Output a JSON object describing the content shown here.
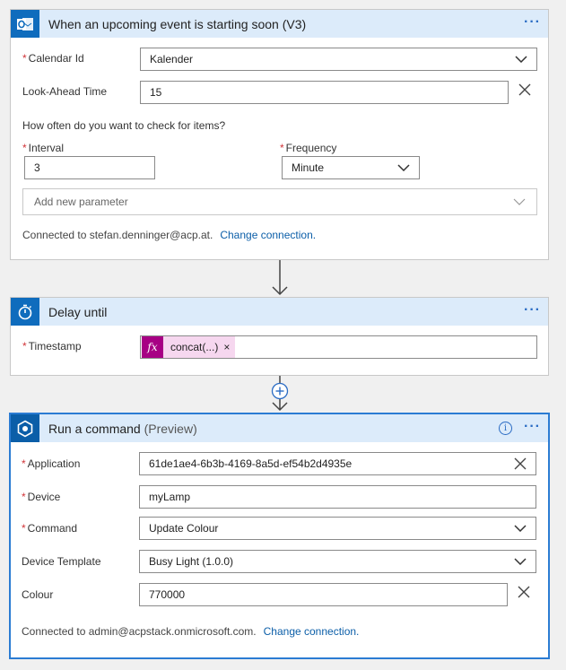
{
  "trigger": {
    "title": "When an upcoming event is starting soon (V3)",
    "calendar_id_label": "Calendar Id",
    "calendar_id_value": "Kalender",
    "lookahead_label": "Look-Ahead Time",
    "lookahead_value": "15",
    "question": "How often do you want to check for items?",
    "interval_label": "Interval",
    "interval_value": "3",
    "frequency_label": "Frequency",
    "frequency_value": "Minute",
    "add_param_placeholder": "Add new parameter",
    "connected_text": "Connected to stefan.denninger@acp.at.",
    "change_connection": "Change connection."
  },
  "delay": {
    "title": "Delay until",
    "timestamp_label": "Timestamp",
    "token_label": "concat(...)",
    "token_remove": "×",
    "fx": "fx"
  },
  "command": {
    "title": "Run a command",
    "subtitle": "(Preview)",
    "application_label": "Application",
    "application_value": "61de1ae4-6b3b-4169-8a5d-ef54b2d4935e",
    "device_label": "Device",
    "device_value": "myLamp",
    "command_label": "Command",
    "command_value": "Update Colour",
    "template_label": "Device Template",
    "template_value": "Busy Light (1.0.0)",
    "colour_label": "Colour",
    "colour_value": "770000",
    "connected_text": "Connected to admin@acpstack.onmicrosoft.com.",
    "change_connection": "Change connection."
  },
  "ui": {
    "more_dots": "···",
    "required_mark": "*",
    "info_glyph": "i"
  }
}
